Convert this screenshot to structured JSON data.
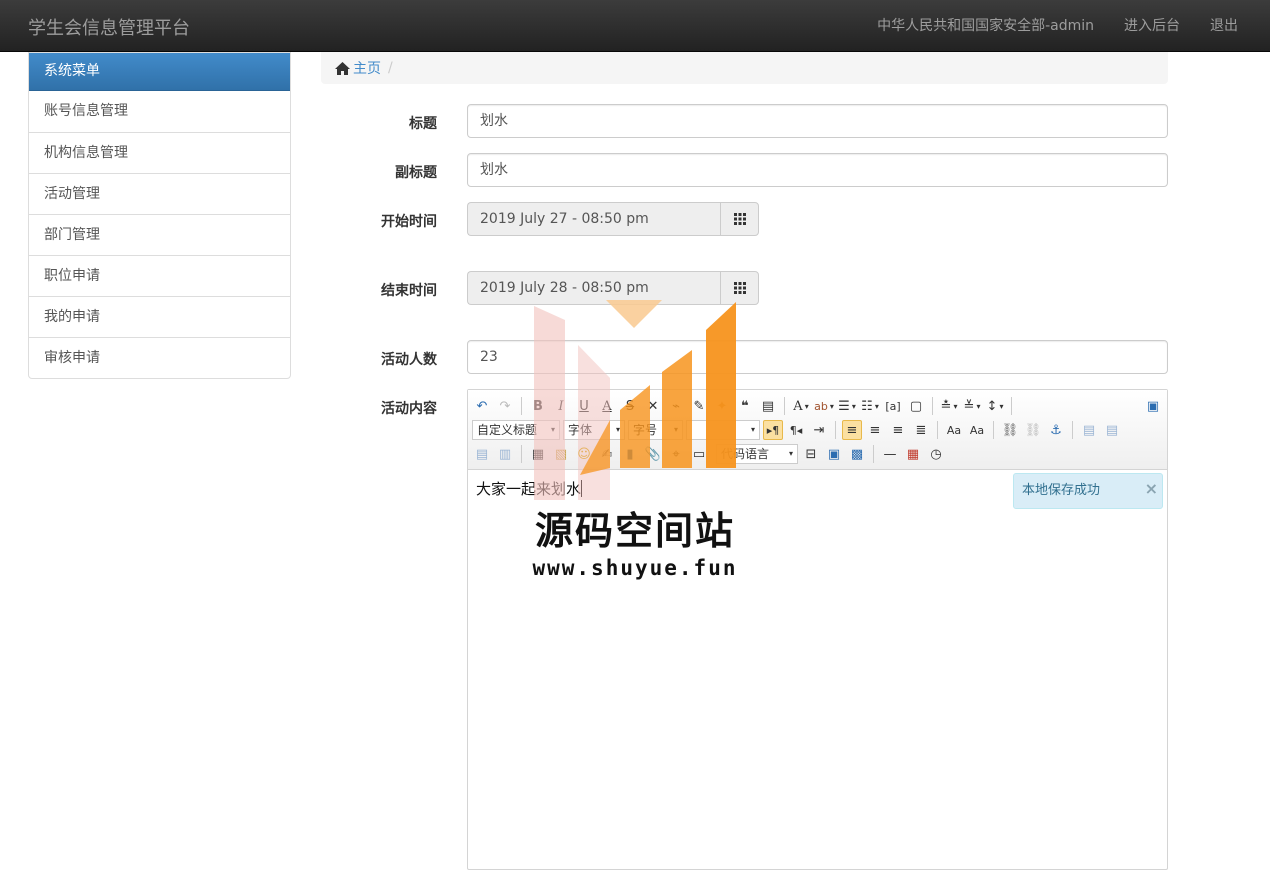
{
  "app": {
    "brand": "学生会信息管理平台",
    "nav": [
      "中华人民共和国国家安全部-admin",
      "进入后台",
      "退出"
    ]
  },
  "sidebar": {
    "title": "系统菜单",
    "items": [
      "账号信息管理",
      "机构信息管理",
      "活动管理",
      "部门管理",
      "职位申请",
      "我的申请",
      "审核申请"
    ]
  },
  "breadcrumb": {
    "home": "主页",
    "separator": "/"
  },
  "form": {
    "title_label": "标题",
    "title_value": "划水",
    "subtitle_label": "副标题",
    "subtitle_value": "划水",
    "start_label": "开始时间",
    "start_value": "2019 July 27 - 08:50 pm",
    "end_label": "结束时间",
    "end_value": "2019 July 28 - 08:50 pm",
    "count_label": "活动人数",
    "count_value": "23",
    "content_label": "活动内容"
  },
  "editor": {
    "heading_select": "自定义标题",
    "font_select": "字体",
    "size_select": "字号",
    "code_select": "代码语言",
    "content": "大家一起来划水",
    "alert": "本地保存成功",
    "alert_close": "×"
  },
  "watermark": {
    "title": "源码空间站",
    "url": "www.shuyue.fun"
  },
  "colors": {
    "primary": "#428bca",
    "navbar": "#222222",
    "watermark_orange": "#f7941d"
  }
}
